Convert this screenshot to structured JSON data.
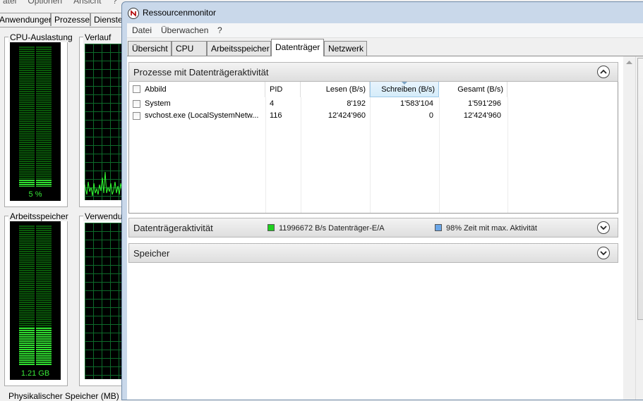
{
  "task_manager": {
    "menu": [
      "atei",
      "Optionen",
      "Ansicht",
      "?"
    ],
    "tabs": [
      "Anwendungen",
      "Prozesse",
      "Dienste"
    ],
    "cpu_label": "CPU-Auslastung",
    "cpu_value": "5 %",
    "cpu_fraction": 0.05,
    "cpu_history_label": "Verlauf der",
    "memory_label": "Arbeitsspeicher",
    "memory_value": "1.21 GB",
    "memory_fraction": 0.27,
    "memory_history_label": "Verwendun",
    "physical_label": "Physikalischer Speicher (MB)"
  },
  "window": {
    "title": "Ressourcenmonitor",
    "icon": "resource-monitor-icon"
  },
  "menubar": [
    "Datei",
    "Überwachen",
    "?"
  ],
  "tabs": [
    "Übersicht",
    "CPU",
    "Arbeitsspeicher",
    "Datenträger",
    "Netzwerk"
  ],
  "active_tab": "Datenträger",
  "processes_section": {
    "title": "Prozesse mit Datenträgeraktivität",
    "columns": [
      "Abbild",
      "PID",
      "Lesen (B/s)",
      "Schreiben (B/s)",
      "Gesamt (B/s)"
    ],
    "sorted_column": "Schreiben (B/s)",
    "rows": [
      {
        "image": "System",
        "pid": "4",
        "read": "8'192",
        "write": "1'583'104",
        "total": "1'591'296"
      },
      {
        "image": "svchost.exe (LocalSystemNetw...",
        "pid": "116",
        "read": "12'424'960",
        "write": "0",
        "total": "12'424'960"
      }
    ]
  },
  "disk_activity_section": {
    "title": "Datenträgeraktivität",
    "io_text": "11996672 B/s Datenträger-E/A",
    "io_color": "#1ed01e",
    "active_time_text": "98% Zeit mit max. Aktivität",
    "active_time_color": "#6aa6e8"
  },
  "storage_section": {
    "title": "Speicher"
  }
}
